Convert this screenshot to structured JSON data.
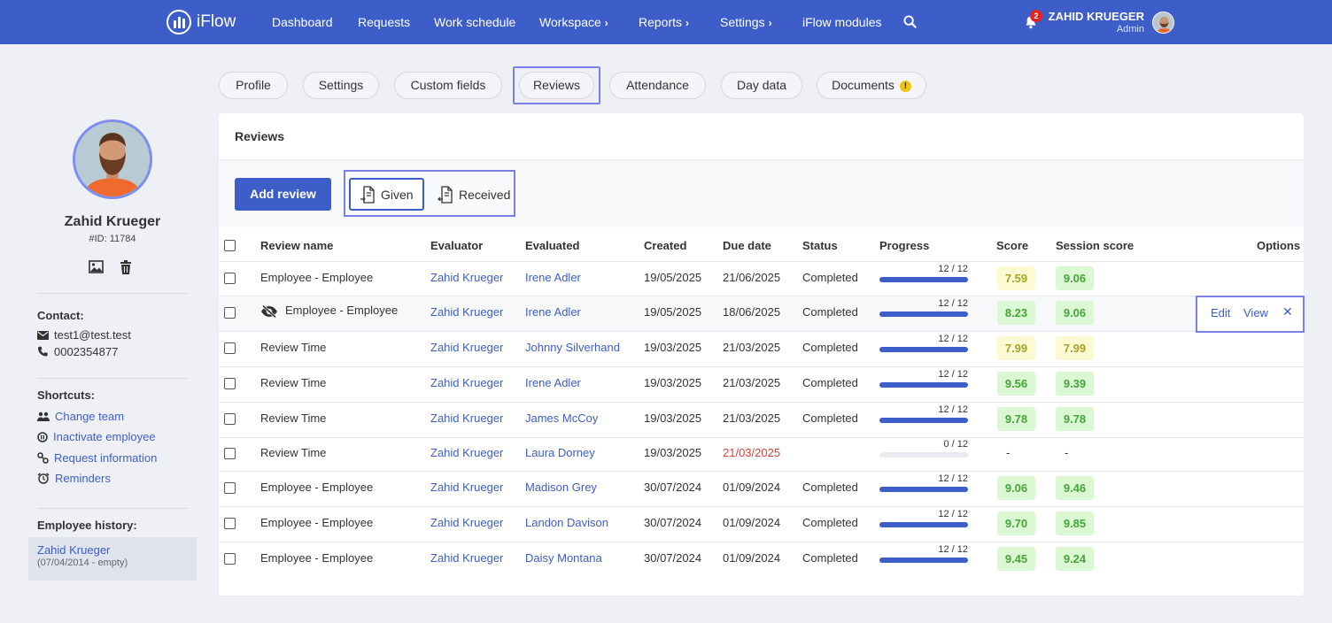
{
  "app": {
    "name": "iFlow"
  },
  "nav": {
    "items": [
      {
        "label": "Dashboard",
        "chevron": false
      },
      {
        "label": "Requests",
        "chevron": false
      },
      {
        "label": "Work schedule",
        "chevron": false
      },
      {
        "label": "Workspace",
        "chevron": true
      },
      {
        "label": "Reports",
        "chevron": true
      },
      {
        "label": "Settings",
        "chevron": true
      },
      {
        "label": "iFlow modules",
        "chevron": false
      }
    ],
    "notifications": "2",
    "user_name": "ZAHID KRUEGER",
    "user_role": "Admin"
  },
  "profile": {
    "name": "Zahid Krueger",
    "id": "#ID: 11784",
    "contact_title": "Contact:",
    "email": "test1@test.test",
    "phone": "0002354877",
    "shortcuts_title": "Shortcuts:",
    "shortcuts": [
      "Change team",
      "Inactivate employee",
      "Request information",
      "Reminders"
    ],
    "history_title": "Employee history:",
    "history_name": "Zahid Krueger",
    "history_dates": "(07/04/2014 - empty)"
  },
  "tabs": [
    "Profile",
    "Settings",
    "Custom fields",
    "Reviews",
    "Attendance",
    "Day data",
    "Documents"
  ],
  "active_tab": "Reviews",
  "reviews": {
    "title": "Reviews",
    "add_label": "Add review",
    "given_label": "Given",
    "received_label": "Received",
    "columns": [
      "Review name",
      "Evaluator",
      "Evaluated",
      "Created",
      "Due date",
      "Status",
      "Progress",
      "Score",
      "Session score",
      "Options"
    ],
    "options": {
      "edit": "Edit",
      "view": "View",
      "close": "✕"
    },
    "rows": [
      {
        "name": "Employee - Employee",
        "hidden": false,
        "evaluator": "Zahid Krueger",
        "evaluated": "Irene Adler",
        "created": "19/05/2025",
        "due": "21/06/2025",
        "overdue": false,
        "status": "Completed",
        "progress_text": "12 / 12",
        "progress": 1.0,
        "score": "7.59",
        "score_color": "yellow",
        "session": "9.06",
        "session_color": "green"
      },
      {
        "name": "Employee - Employee",
        "hidden": true,
        "evaluator": "Zahid Krueger",
        "evaluated": "Irene Adler",
        "created": "19/05/2025",
        "due": "18/06/2025",
        "overdue": false,
        "status": "Completed",
        "progress_text": "12 / 12",
        "progress": 1.0,
        "score": "8.23",
        "score_color": "green",
        "session": "9.06",
        "session_color": "green"
      },
      {
        "name": "Review Time",
        "hidden": false,
        "evaluator": "Zahid Krueger",
        "evaluated": "Johnny Silverhand",
        "created": "19/03/2025",
        "due": "21/03/2025",
        "overdue": false,
        "status": "Completed",
        "progress_text": "12 / 12",
        "progress": 1.0,
        "score": "7.99",
        "score_color": "yellow",
        "session": "7.99",
        "session_color": "yellow"
      },
      {
        "name": "Review Time",
        "hidden": false,
        "evaluator": "Zahid Krueger",
        "evaluated": "Irene Adler",
        "created": "19/03/2025",
        "due": "21/03/2025",
        "overdue": false,
        "status": "Completed",
        "progress_text": "12 / 12",
        "progress": 1.0,
        "score": "9.56",
        "score_color": "green",
        "session": "9.39",
        "session_color": "green"
      },
      {
        "name": "Review Time",
        "hidden": false,
        "evaluator": "Zahid Krueger",
        "evaluated": "James McCoy",
        "created": "19/03/2025",
        "due": "21/03/2025",
        "overdue": false,
        "status": "Completed",
        "progress_text": "12 / 12",
        "progress": 1.0,
        "score": "9.78",
        "score_color": "green",
        "session": "9.78",
        "session_color": "green"
      },
      {
        "name": "Review Time",
        "hidden": false,
        "evaluator": "Zahid Krueger",
        "evaluated": "Laura Dorney",
        "created": "19/03/2025",
        "due": "21/03/2025",
        "overdue": true,
        "status": "",
        "progress_text": "0 / 12",
        "progress": 0.0,
        "score": "-",
        "score_color": "none",
        "session": "-",
        "session_color": "none"
      },
      {
        "name": "Employee - Employee",
        "hidden": false,
        "evaluator": "Zahid Krueger",
        "evaluated": "Madison Grey",
        "created": "30/07/2024",
        "due": "01/09/2024",
        "overdue": false,
        "status": "Completed",
        "progress_text": "12 / 12",
        "progress": 1.0,
        "score": "9.06",
        "score_color": "green",
        "session": "9.46",
        "session_color": "green"
      },
      {
        "name": "Employee - Employee",
        "hidden": false,
        "evaluator": "Zahid Krueger",
        "evaluated": "Landon Davison",
        "created": "30/07/2024",
        "due": "01/09/2024",
        "overdue": false,
        "status": "Completed",
        "progress_text": "12 / 12",
        "progress": 1.0,
        "score": "9.70",
        "score_color": "green",
        "session": "9.85",
        "session_color": "green"
      },
      {
        "name": "Employee - Employee",
        "hidden": false,
        "evaluator": "Zahid Krueger",
        "evaluated": "Daisy Montana",
        "created": "30/07/2024",
        "due": "01/09/2024",
        "overdue": false,
        "status": "Completed",
        "progress_text": "12 / 12",
        "progress": 1.0,
        "score": "9.45",
        "score_color": "green",
        "session": "9.24",
        "session_color": "green"
      }
    ]
  },
  "colors": {
    "primary": "#3d5ec9",
    "highlight_frame": "#7b7fe8",
    "score_green": "#46a53a",
    "score_yellow": "#a9a425",
    "overdue": "#e0403a"
  }
}
